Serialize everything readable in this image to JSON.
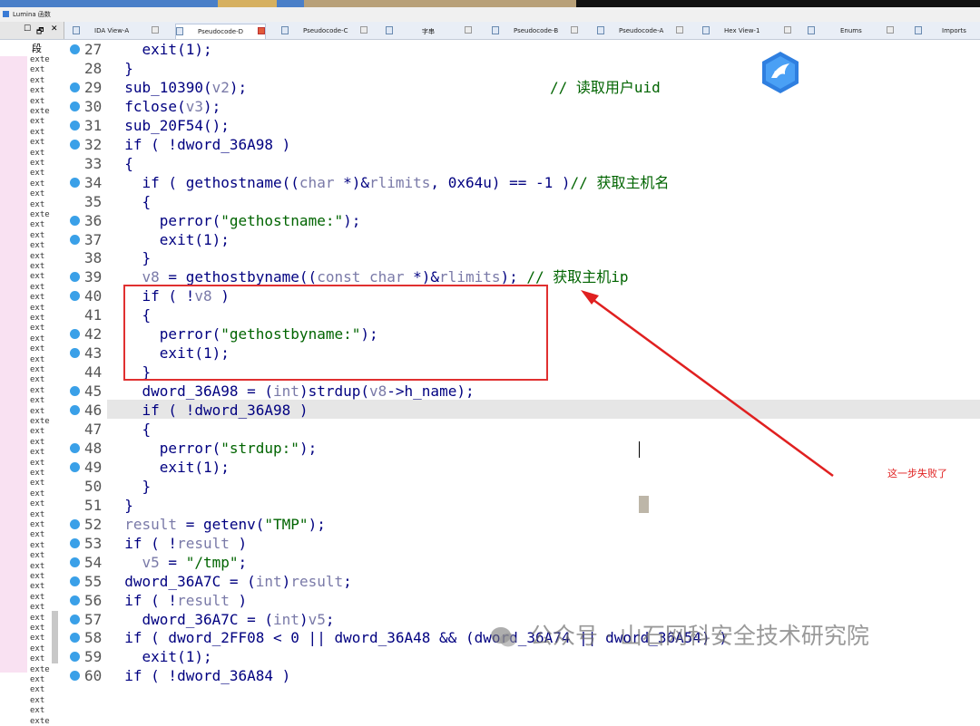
{
  "lumina": {
    "title": "Lumina 函数"
  },
  "panel": {
    "header": "段",
    "controls": [
      "☐",
      "🗗",
      "✕"
    ]
  },
  "tabs": [
    {
      "label": "IDA View-A",
      "active": false
    },
    {
      "label": "Pseudocode-D",
      "active": true
    },
    {
      "label": "Pseudocode-C",
      "active": false
    },
    {
      "label": "字串",
      "active": false
    },
    {
      "label": "Pseudocode-B",
      "active": false
    },
    {
      "label": "Pseudocode-A",
      "active": false
    },
    {
      "label": "Hex View-1",
      "active": false
    },
    {
      "label": "Enums",
      "active": false
    },
    {
      "label": "Imports",
      "active": false
    }
  ],
  "segments": [
    "exte",
    "ext",
    "ext",
    "ext",
    "ext",
    "exte",
    "ext",
    "ext",
    "ext",
    "ext",
    "ext",
    "ext",
    "ext",
    "ext",
    "ext",
    "exte",
    "ext",
    "ext",
    "ext",
    "ext",
    "ext",
    "ext",
    "ext",
    "ext",
    "ext",
    "ext",
    "ext",
    "ext",
    "ext",
    "ext",
    "ext",
    "ext",
    "ext",
    "ext",
    "ext",
    "exte",
    "ext",
    "ext",
    "ext",
    "ext",
    "ext",
    "ext",
    "ext",
    "ext",
    "ext",
    "ext",
    "ext",
    "ext",
    "ext",
    "ext",
    "ext",
    "ext",
    "ext",
    "ext",
    "ext",
    "ext",
    "ext",
    "ext",
    "ext",
    "exte",
    "ext",
    "ext",
    "ext",
    "ext",
    "exte"
  ],
  "gutter": [
    {
      "n": "27",
      "dot": true
    },
    {
      "n": "28",
      "dot": false
    },
    {
      "n": "29",
      "dot": true
    },
    {
      "n": "30",
      "dot": true
    },
    {
      "n": "31",
      "dot": true
    },
    {
      "n": "32",
      "dot": true
    },
    {
      "n": "33",
      "dot": false
    },
    {
      "n": "34",
      "dot": true
    },
    {
      "n": "35",
      "dot": false
    },
    {
      "n": "36",
      "dot": true
    },
    {
      "n": "37",
      "dot": true
    },
    {
      "n": "38",
      "dot": false
    },
    {
      "n": "39",
      "dot": true
    },
    {
      "n": "40",
      "dot": true
    },
    {
      "n": "41",
      "dot": false
    },
    {
      "n": "42",
      "dot": true
    },
    {
      "n": "43",
      "dot": true
    },
    {
      "n": "44",
      "dot": false
    },
    {
      "n": "45",
      "dot": true
    },
    {
      "n": "46",
      "dot": true
    },
    {
      "n": "47",
      "dot": false
    },
    {
      "n": "48",
      "dot": true
    },
    {
      "n": "49",
      "dot": true
    },
    {
      "n": "50",
      "dot": false
    },
    {
      "n": "51",
      "dot": false
    },
    {
      "n": "52",
      "dot": true
    },
    {
      "n": "53",
      "dot": true
    },
    {
      "n": "54",
      "dot": true
    },
    {
      "n": "55",
      "dot": true
    },
    {
      "n": "56",
      "dot": true
    },
    {
      "n": "57",
      "dot": true
    },
    {
      "n": "58",
      "dot": true
    },
    {
      "n": "59",
      "dot": true
    },
    {
      "n": "60",
      "dot": true
    }
  ],
  "code": [
    [
      [
        "p",
        "    exit(1);"
      ]
    ],
    [
      [
        "p",
        "  }"
      ]
    ],
    [
      [
        "p",
        "  sub_10390("
      ],
      [
        "v",
        "v2"
      ],
      [
        "p",
        ");"
      ]
    ],
    [
      [
        "p",
        "  fclose("
      ],
      [
        "v",
        "v3"
      ],
      [
        "p",
        ");"
      ]
    ],
    [
      [
        "p",
        "  sub_20F54();"
      ]
    ],
    [
      [
        "p",
        "  if ( !dword_36A98 )"
      ]
    ],
    [
      [
        "p",
        "  {"
      ]
    ],
    [
      [
        "p",
        "    if ( gethostname(("
      ],
      [
        "v",
        "char"
      ],
      [
        "p",
        " *)&"
      ],
      [
        "v",
        "rlimits"
      ],
      [
        "p",
        ", 0x64u) == -1 )"
      ],
      [
        "s",
        "// 获取主机名"
      ]
    ],
    [
      [
        "p",
        "    {"
      ]
    ],
    [
      [
        "p",
        "      perror("
      ],
      [
        "s",
        "\"gethostname:\""
      ],
      [
        "p",
        ");"
      ]
    ],
    [
      [
        "p",
        "      exit(1);"
      ]
    ],
    [
      [
        "p",
        "    }"
      ]
    ],
    [
      [
        "v",
        "    v8"
      ],
      [
        "p",
        " = gethostbyname(("
      ],
      [
        "v",
        "const char"
      ],
      [
        "p",
        " *)&"
      ],
      [
        "v",
        "rlimits"
      ],
      [
        "p",
        "); "
      ],
      [
        "s",
        "// 获取主机ip"
      ]
    ],
    [
      [
        "p",
        "    if ( !"
      ],
      [
        "v",
        "v8"
      ],
      [
        "p",
        " )"
      ]
    ],
    [
      [
        "p",
        "    {"
      ]
    ],
    [
      [
        "p",
        "      perror("
      ],
      [
        "s",
        "\"gethostbyname:\""
      ],
      [
        "p",
        ");"
      ]
    ],
    [
      [
        "p",
        "      exit(1);"
      ]
    ],
    [
      [
        "p",
        "    }"
      ]
    ],
    [
      [
        "p",
        "    dword_36A98 = ("
      ],
      [
        "v",
        "int"
      ],
      [
        "p",
        ")strdup("
      ],
      [
        "v",
        "v8"
      ],
      [
        "p",
        "->h_name);"
      ]
    ],
    [
      [
        "p",
        "    if ( !dword_36A98 )"
      ]
    ],
    [
      [
        "p",
        "    {"
      ]
    ],
    [
      [
        "p",
        "      perror("
      ],
      [
        "s",
        "\"strdup:\""
      ],
      [
        "p",
        ");"
      ]
    ],
    [
      [
        "p",
        "      exit(1);"
      ]
    ],
    [
      [
        "p",
        "    }"
      ]
    ],
    [
      [
        "p",
        "  }"
      ]
    ],
    [
      [
        "v",
        "  result"
      ],
      [
        "p",
        " = getenv("
      ],
      [
        "s",
        "\"TMP\""
      ],
      [
        "p",
        ");"
      ]
    ],
    [
      [
        "p",
        "  if ( !"
      ],
      [
        "v",
        "result"
      ],
      [
        "p",
        " )"
      ]
    ],
    [
      [
        "v",
        "    v5"
      ],
      [
        "p",
        " = "
      ],
      [
        "s",
        "\"/tmp\""
      ],
      [
        "p",
        ";"
      ]
    ],
    [
      [
        "p",
        "  dword_36A7C = ("
      ],
      [
        "v",
        "int"
      ],
      [
        "p",
        ")"
      ],
      [
        "v",
        "result"
      ],
      [
        "p",
        ";"
      ]
    ],
    [
      [
        "p",
        "  if ( !"
      ],
      [
        "v",
        "result"
      ],
      [
        "p",
        " )"
      ]
    ],
    [
      [
        "p",
        "    dword_36A7C = ("
      ],
      [
        "v",
        "int"
      ],
      [
        "p",
        ")"
      ],
      [
        "v",
        "v5"
      ],
      [
        "p",
        ";"
      ]
    ],
    [
      [
        "p",
        "  if ( dword_2FF08 < 0 || dword_36A48 && (dword_36A74 || dword_36A54) )"
      ]
    ],
    [
      [
        "p",
        "    exit(1);"
      ]
    ],
    [
      [
        "p",
        "  if ( !dword_36A84 )"
      ]
    ]
  ],
  "comment_uid": "// 读取用户uid",
  "annotation": "这一步失败了",
  "watermark": "公众号 · 山石网科安全技术研究院",
  "colors": {
    "keyword": "#000080",
    "var": "#7a7aa8",
    "string": "#006400",
    "annot": "#e02020",
    "breakpoint": "#3aa0e8"
  }
}
